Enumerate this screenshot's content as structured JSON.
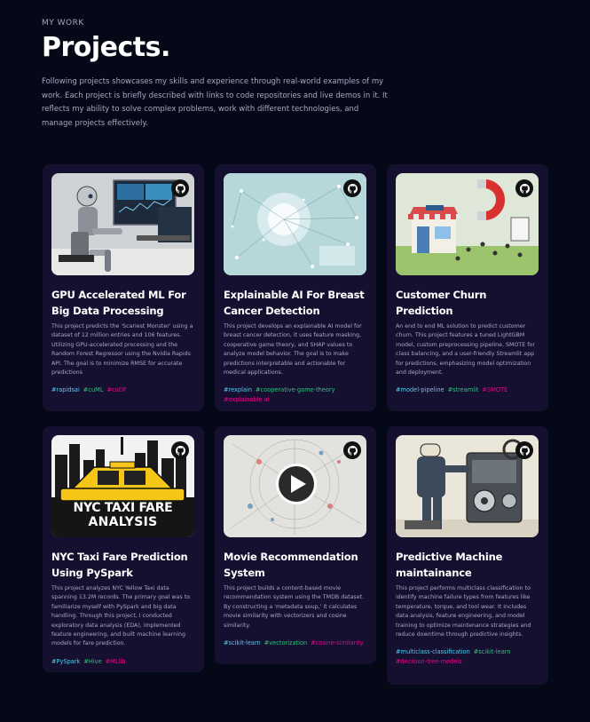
{
  "header": {
    "kicker": "MY WORK",
    "title": "Projects.",
    "intro": "Following projects showcases my skills and experience through real-world examples of my work. Each project is briefly described with links to code repositories and live demos in it. It reflects my ability to solve complex problems, work with different technologies, and manage projects effectively."
  },
  "colors": {
    "background": "#050816",
    "card": "#151030",
    "muted_text": "#aaa6c3",
    "tag_blue": "#56ccf2",
    "tag_green": "#2ec27e",
    "tag_pink": "#ec008c"
  },
  "projects": [
    {
      "title": "GPU Accelerated ML For Big Data Processing",
      "description": "This project predicts the 'Scariest Monster' using a dataset of 12 million entries and 106 features. Utilizing GPU-accelerated processing and the Random Forest Regressor using the Nvidia Rapids API. The goal is to minimize RMSE for accurate predictions",
      "tags": [
        {
          "label": "#rapidsai",
          "color": "blue"
        },
        {
          "label": "#cuML",
          "color": "green"
        },
        {
          "label": "#cuDF",
          "color": "pink"
        }
      ],
      "image_icon": "robot-at-computer-image",
      "link_icon": "github-icon"
    },
    {
      "title": "Explainable AI For Breast Cancer Detection",
      "description": "This project develops an explainable AI model for breast cancer detection, it uses feature masking, cooperative game theory, and SHAP values to analyze model behavior. The goal is to make predictions interpretable and actionable for medical applications.",
      "tags": [
        {
          "label": "#rexplain",
          "color": "blue"
        },
        {
          "label": "#cooperative-game-theory",
          "color": "green"
        },
        {
          "label": "#explainable ai",
          "color": "pink"
        }
      ],
      "image_icon": "data-network-image",
      "link_icon": "github-icon"
    },
    {
      "title": "Customer Churn Prediction",
      "description": "An end to end ML solution to predict customer churn. This project features a tuned LightGBM model, custom preprocessing pipeline, SMOTE for class balancing, and a user-friendly Streamlit app for predictions, emphasizing model optimization and deployment.",
      "tags": [
        {
          "label": "#model-pipeline",
          "color": "blue"
        },
        {
          "label": "#streamlit",
          "color": "green"
        },
        {
          "label": "#SMOTE",
          "color": "pink"
        }
      ],
      "image_icon": "store-magnet-image",
      "link_icon": "github-icon"
    },
    {
      "title": "NYC Taxi Fare Prediction Using PySpark",
      "description": "This project analyzes NYC Yellow Taxi data spanning 13.2M records. The primary goal was to familiarize myself with PySpark and big data handling. Through this project, I conducted exploratory data analysis (EDA), implemented feature engineering, and built machine learning models for fare prediction.",
      "tags": [
        {
          "label": "#PySpark",
          "color": "blue"
        },
        {
          "label": "#Hive",
          "color": "green"
        },
        {
          "label": "#MLlib",
          "color": "pink"
        }
      ],
      "image_icon": "taxi-poster-image",
      "image_text_1": "NYC TAXI FARE",
      "image_text_2": "ANALYSIS",
      "link_icon": "github-icon"
    },
    {
      "title": "Movie Recommendation System",
      "description": "This project builds a content-based movie recommendation system using the TMDB dataset. By constructing a 'metadata soup,' it calculates movie similarity with vectorizers and cosine similarity.",
      "tags": [
        {
          "label": "#scikit-learn",
          "color": "blue"
        },
        {
          "label": "#vectorization",
          "color": "green"
        },
        {
          "label": "#cosine-similarity",
          "color": "pink"
        }
      ],
      "image_icon": "play-button-image",
      "link_icon": "github-icon"
    },
    {
      "title": "Predictive Machine maintainance",
      "description": "This project performs multiclass classification to identify machine failure types from features like temperature, torque, and tool wear. It includes data analysis, feature engineering, and model training to optimize maintenance strategies and reduce downtime through predictive insights.",
      "tags": [
        {
          "label": "#multiclass-classification",
          "color": "blue"
        },
        {
          "label": "#scikit-learn",
          "color": "green"
        },
        {
          "label": "#decision-tree-models",
          "color": "pink"
        }
      ],
      "image_icon": "machine-repair-image",
      "link_icon": "github-icon"
    }
  ]
}
